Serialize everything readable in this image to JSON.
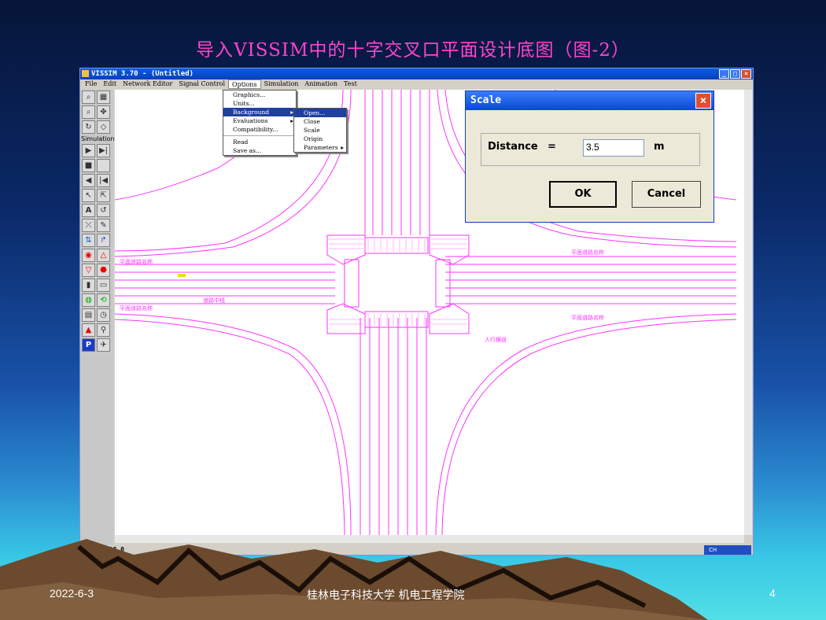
{
  "slide": {
    "title": "导入VISSIM中的十字交叉口平面设计底图（图-2）",
    "footer_date": "2022-6-3",
    "footer_center": "桂林电子科技大学   机电工程学院",
    "page_number": "4"
  },
  "app": {
    "title": "VISSIM 3.70 - (Untitled)",
    "menus": [
      "File",
      "Edit",
      "Network Editor",
      "Signal Control",
      "Options",
      "Simulation",
      "Animation",
      "Test"
    ],
    "options_menu": [
      "Graphics...",
      "Units...",
      "Background",
      "Evaluations",
      "Compatibility...",
      "Read",
      "Save as..."
    ],
    "background_submenu": [
      "Open...",
      "Close",
      "Scale",
      "Origin",
      "Parameters"
    ],
    "toolbar_label": "Simulation",
    "status_coord": "178.8:-18.0",
    "tray_text": "CH"
  },
  "drawing_labels": {
    "left_top": "平面道路名称",
    "left_bottom": "平面道路名称",
    "left_mid": "道路中线",
    "right_top": "平面道路名称",
    "right_bottom": "平面道路名称",
    "lower_right": "人行横道"
  },
  "dialog": {
    "title": "Scale",
    "distance_label": "Distance",
    "equals": "=",
    "distance_value": "3.5",
    "unit": "m",
    "ok": "OK",
    "cancel": "Cancel"
  },
  "colors": {
    "drawing": "#ff33ff",
    "title_accent": "#ff44cc"
  }
}
